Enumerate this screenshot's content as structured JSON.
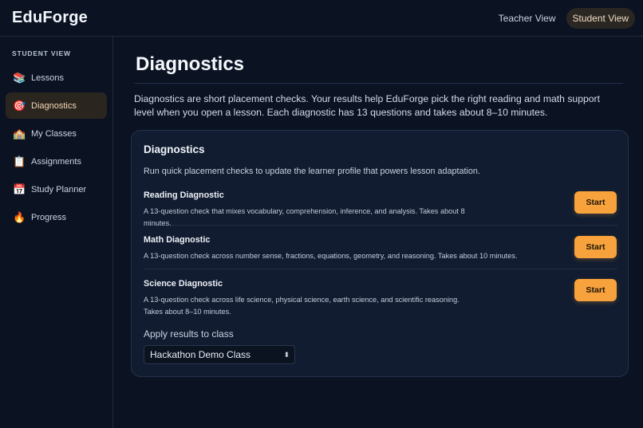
{
  "app": {
    "brand": "EduForge",
    "views": [
      {
        "label": "Teacher View",
        "active": false
      },
      {
        "label": "Student View",
        "active": true
      }
    ]
  },
  "sidebar": {
    "heading": "STUDENT VIEW",
    "items": [
      {
        "label": "Lessons",
        "icon": "books-icon",
        "glyph": "📚"
      },
      {
        "label": "Diagnostics",
        "icon": "target-icon",
        "glyph": "🎯",
        "active": true
      },
      {
        "label": "My Classes",
        "icon": "school-icon",
        "glyph": "🏫"
      },
      {
        "label": "Assignments",
        "icon": "clipboard-icon",
        "glyph": "📋"
      },
      {
        "label": "Study Planner",
        "icon": "calendar-icon",
        "glyph": "📅"
      },
      {
        "label": "Progress",
        "icon": "fire-icon",
        "glyph": "🔥"
      }
    ]
  },
  "main": {
    "title": "Diagnostics",
    "intro": "Diagnostics are short placement checks. Your results help EduForge pick the right reading and math support level when you open a lesson. Each diagnostic has 13 questions and takes about 8–10 minutes.",
    "card": {
      "title": "Diagnostics",
      "subtitle": "Run quick placement checks to update the learner profile that powers lesson adaptation.",
      "diagnostics": [
        {
          "name": "Reading Diagnostic",
          "description": "A 13-question check that mixes vocabulary, comprehension, inference, and analysis. Takes about 8 minutes.",
          "button": "Start"
        },
        {
          "name": "Math Diagnostic",
          "description": "A 13-question check across number sense, fractions, equations, geometry, and reasoning. Takes about 10 minutes.",
          "button": "Start"
        },
        {
          "name": "Science Diagnostic",
          "description": "A 13-question check across life science, physical science, earth science, and scientific reasoning. Takes about 8–10 minutes.",
          "button": "Start"
        }
      ],
      "apply_label": "Apply results to class",
      "class_select": {
        "value": "Hackathon Demo Class"
      }
    }
  },
  "colors": {
    "background": "#0b1322",
    "accent": "#f7a23c",
    "active_nav": "#2b251f"
  }
}
